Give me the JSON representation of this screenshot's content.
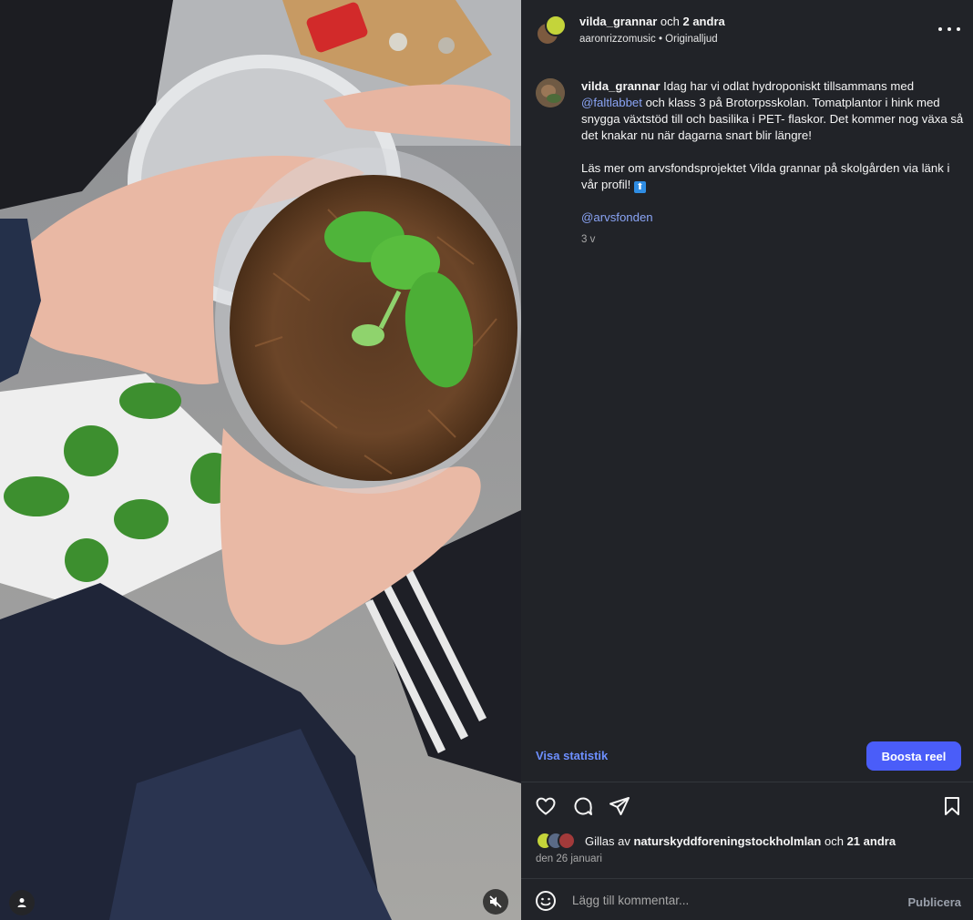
{
  "media": {
    "tag_icon": "user-tag-icon",
    "mute_icon": "speaker-muted-icon"
  },
  "header": {
    "username": "vilda_grannar",
    "joiner": "och",
    "others": "2 andra",
    "audio_user": "aaronrizzomusic",
    "audio_sep": "•",
    "audio_label": "Originalljud",
    "more_icon": "more-horizontal-icon"
  },
  "caption": {
    "username": "vilda_grannar",
    "text_before_mention": "Idag har vi odlat hydroponiskt tillsammans med",
    "mention1": "@faltlabbet",
    "text_after_mention": "och klass 3 på Brotorpsskolan. Tomatplantor i hink med snygga växtstöd till och basilika i PET- flaskor. Det kommer nog växa så det knakar nu när dagarna snart blir längre!",
    "paragraph2": "Läs mer om arvsfondsprojektet Vilda grannar på skolgården via länk i vår profil!",
    "emoji": "⬆",
    "mention2": "@arvsfonden",
    "age": "3 v"
  },
  "insights_label": "Visa statistik",
  "boost_label": "Boosta reel",
  "actions": {
    "like_icon": "heart-icon",
    "comment_icon": "comment-icon",
    "share_icon": "send-icon",
    "save_icon": "bookmark-icon"
  },
  "likes": {
    "prefix": "Gillas av",
    "user": "naturskyddforeningstockholmlan",
    "joiner": "och",
    "others": "21 andra"
  },
  "date": "den 26 januari",
  "comment": {
    "placeholder": "Lägg till kommentar...",
    "publish_label": "Publicera",
    "emoji_icon": "smiley-icon"
  },
  "colors": {
    "panel_bg": "#212328",
    "accent_link": "#8aa4f5",
    "boost_button": "#4a5df9"
  }
}
